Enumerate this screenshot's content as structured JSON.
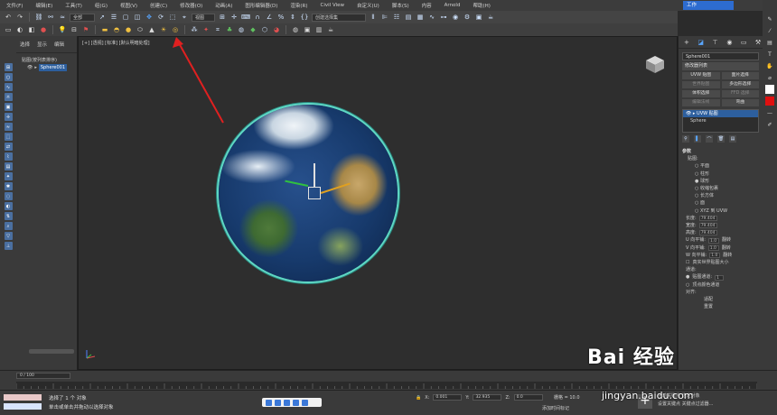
{
  "menu": {
    "items": [
      "文件(F)",
      "编辑(E)",
      "工具(T)",
      "组(G)",
      "视图(V)",
      "创建(C)",
      "修改器(O)",
      "动画(A)",
      "图形编辑器(D)",
      "渲染(R)",
      "Civil View",
      "自定义(U)",
      "脚本(S)",
      "内容",
      "Arnold",
      "帮助(H)"
    ],
    "workspace": "工作"
  },
  "toolbar": {
    "selection_filter": "全部",
    "ref_coord": "视图",
    "named_selection": "创建选择集"
  },
  "explorer": {
    "tabs": [
      "选择",
      "显示",
      "编辑"
    ],
    "root_label": "贴图(按列表排序)",
    "item_label": "Sphere001"
  },
  "viewport": {
    "label": "[+] [透视] [标准] [默认明暗处理]"
  },
  "command_panel": {
    "object_name": "Sphere001",
    "modifier_list": "修改器列表",
    "buttons": [
      "UVW 贴图",
      "面片选择",
      "世界贴图",
      "多边形选择",
      "体积选择",
      "FFD 选择",
      "编辑法线",
      "弯曲",
      "挤压",
      "壳"
    ],
    "stack_active": "UVW 贴图",
    "stack_base": "Sphere",
    "rollout_title": "参数",
    "mapping_label": "贴图:",
    "mapping_options": [
      "平面",
      "柱形",
      "球形",
      "收缩包裹",
      "长方体",
      "面",
      "XYZ 到 UVW"
    ],
    "length_label": "长度:",
    "length_value": "79.404",
    "width_label": "宽度:",
    "width_value": "79.404",
    "height_label": "高度:",
    "height_value": "79.404",
    "u_tile": "U 向平铺:",
    "v_tile": "V 向平铺:",
    "w_tile": "W 向平铺:",
    "tile_value": "1.0",
    "flip": "翻转",
    "real_world": "真实世界贴图大小",
    "channel_label": "通道:",
    "map_channel": "贴图通道:",
    "map_channel_value": "1",
    "vertex_color": "顶点颜色通道",
    "align_label": "对齐:",
    "fit_btn": "适配",
    "reset_btn": "重置"
  },
  "timeline": {
    "frame": "0 / 100"
  },
  "status": {
    "line1": "选择了 1 个 对象",
    "line2": "单击或单击并拖动以选择对象",
    "x_value": "0.001",
    "y_value": "32.935",
    "z_value": "0.0",
    "grid": "栅格 = 10.0",
    "add_time": "添加时间标记",
    "auto_key": "自动关键点",
    "set_key": "设置关键点",
    "selected_obj": "选定对象",
    "key_filter": "关键点过滤器..."
  },
  "watermark": {
    "text": "Bai 经验",
    "url": "jingyan.baidu.com"
  }
}
